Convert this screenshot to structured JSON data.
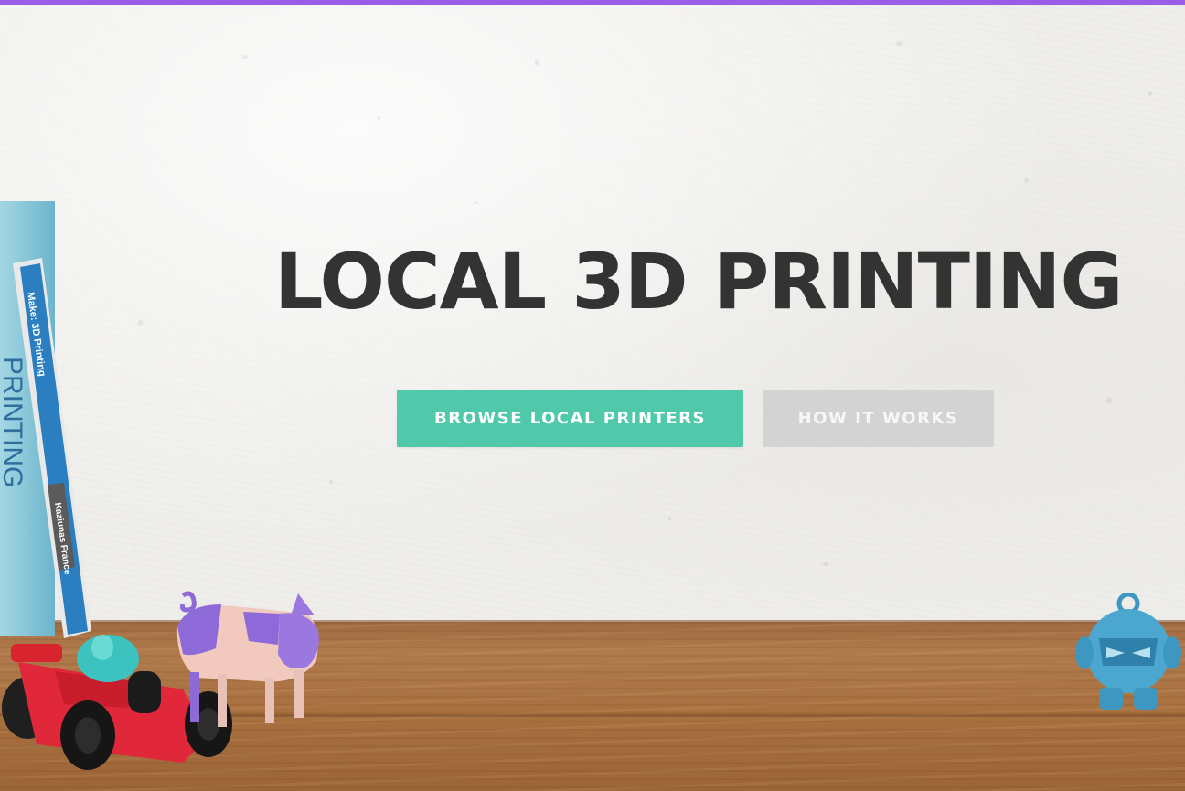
{
  "hero": {
    "title": "LOCAL 3D PRINTING",
    "primary_button": "BROWSE LOCAL PRINTERS",
    "secondary_button": "HOW IT WORKS"
  },
  "colors": {
    "accent_bar": "#9b5de5",
    "primary_button": "#4fc9aa",
    "secondary_button": "#d3d3d3",
    "headline": "#333333"
  },
  "decor": {
    "book_spine_large": "PRINTING",
    "book_spine_small": "Make: 3D Printing",
    "book_author": "Kaziunas France",
    "icons": [
      "stack-of-books-icon",
      "race-car-figurine-icon",
      "pig-figurine-icon",
      "robot-keychain-icon"
    ]
  }
}
